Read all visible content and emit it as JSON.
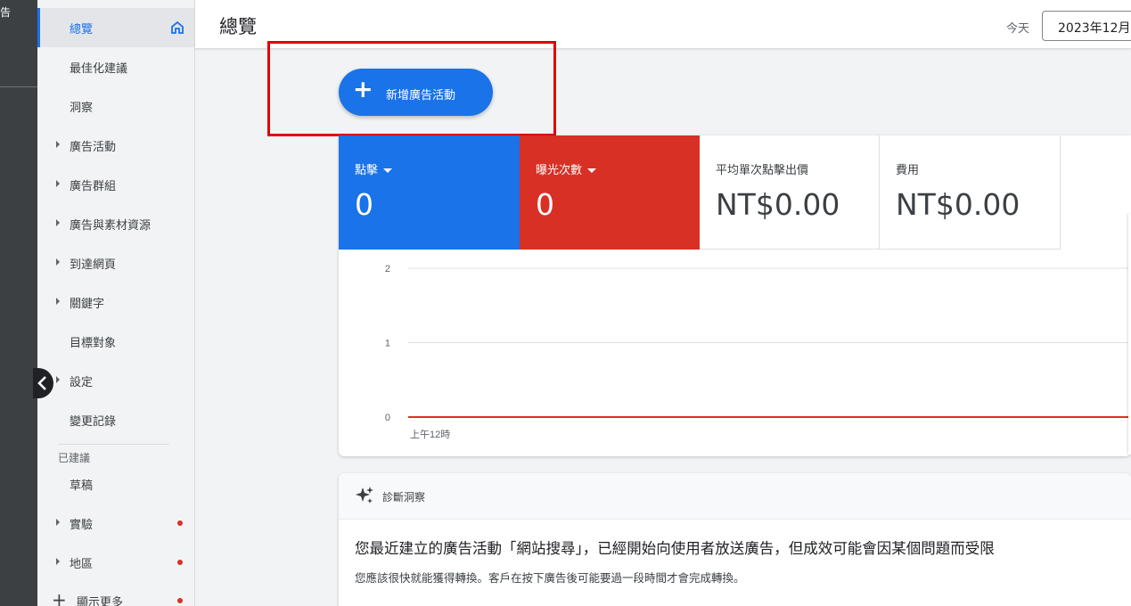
{
  "rail": {
    "label": "告"
  },
  "sidebar": {
    "items": [
      {
        "label": "總覽",
        "active": true,
        "caret": false,
        "dot": false
      },
      {
        "label": "最佳化建議",
        "caret": false,
        "dot": false
      },
      {
        "label": "洞察",
        "caret": false,
        "dot": false
      },
      {
        "label": "廣告活動",
        "caret": true,
        "dot": false
      },
      {
        "label": "廣告群組",
        "caret": true,
        "dot": false
      },
      {
        "label": "廣告與素材資源",
        "caret": true,
        "dot": false
      },
      {
        "label": "到達網頁",
        "caret": true,
        "dot": false
      },
      {
        "label": "關鍵字",
        "caret": true,
        "dot": false
      },
      {
        "label": "目標對象",
        "caret": false,
        "dot": false
      },
      {
        "label": "設定",
        "caret": true,
        "dot": false
      },
      {
        "label": "變更記錄",
        "caret": false,
        "dot": false
      }
    ],
    "section_head": "已建議",
    "section_items": [
      {
        "label": "草稿",
        "caret": false,
        "dot": false
      },
      {
        "label": "實驗",
        "caret": true,
        "dot": true
      },
      {
        "label": "地區",
        "caret": true,
        "dot": true
      },
      {
        "label": "顯示更多",
        "caret": false,
        "dot": true
      }
    ],
    "plus": "+"
  },
  "header": {
    "title": "總覽",
    "today_label": "今天",
    "date_value": "2023年12月"
  },
  "new_campaign": {
    "plus": "+",
    "label": "新增廣告活動"
  },
  "metrics": [
    {
      "label": "點擊",
      "value": "0",
      "color": "#1a73e8"
    },
    {
      "label": "曝光次數",
      "value": "0",
      "color": "#d93025"
    },
    {
      "label": "平均單次點擊出價",
      "value": "NT$0.00"
    },
    {
      "label": "費用",
      "value": "NT$0.00"
    }
  ],
  "chart_data": {
    "type": "line",
    "x": [
      "上午12時"
    ],
    "y_ticks": [
      "2",
      "1",
      "0"
    ],
    "ylim": [
      0,
      2
    ],
    "grid": true,
    "series": [
      {
        "values": [
          0
        ],
        "color": "#d93025"
      }
    ]
  },
  "insight": {
    "title": "診斷洞察",
    "main": "您最近建立的廣告活動「網站搜尋」，已經開始向使用者放送廣告，但成效可能會因某個問題而受限",
    "sub": "您應該很快就能獲得轉換。客戶在按下廣告後可能要過一段時間才會完成轉換。"
  }
}
